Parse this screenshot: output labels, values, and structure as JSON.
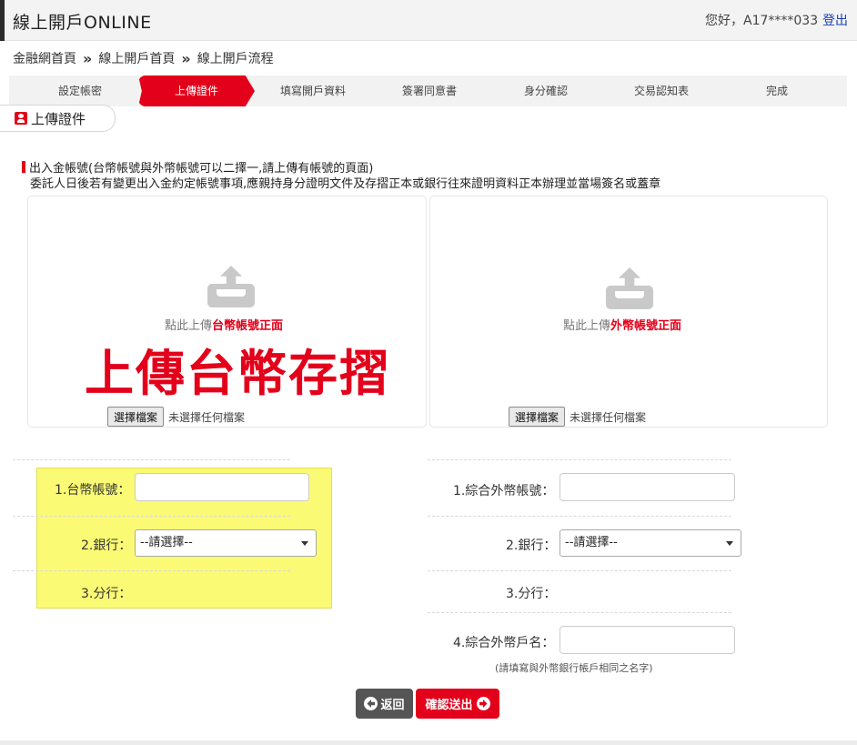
{
  "header": {
    "title": "線上開戶ONLINE",
    "greeting": "您好，",
    "user_id": "A17****033",
    "logout": "登出"
  },
  "breadcrumb": {
    "items": [
      "金融網首頁",
      "線上開戶首頁",
      "線上開戶流程"
    ],
    "separator": "»"
  },
  "steps": {
    "items": [
      "設定帳密",
      "上傳證件",
      "填寫開戶資料",
      "簽署同意書",
      "身分確認",
      "交易認知表",
      "完成"
    ],
    "active_index": 1
  },
  "section": {
    "title": "上傳證件",
    "icon": "id-card-icon"
  },
  "notes": {
    "line1": "出入金帳號(台幣帳號與外幣帳號可以二擇一,請上傳有帳號的頁面)",
    "line2": "委託人日後若有變更出入金約定帳號事項,應親持身分證明文件及存摺正本或銀行往來證明資料正本辦理並當場簽名或蓋章"
  },
  "upload": {
    "left": {
      "hint_prefix": "點此上傳",
      "hint_highlight": "台幣帳號正面",
      "file_button": "選擇檔案",
      "file_status": "未選擇任何檔案",
      "overlay_text": "上傳台幣存摺"
    },
    "right": {
      "hint_prefix": "點此上傳",
      "hint_highlight": "外幣帳號正面",
      "file_button": "選擇檔案",
      "file_status": "未選擇任何檔案"
    }
  },
  "form": {
    "twd": {
      "account_label": "1.台幣帳號：",
      "account_value": "",
      "bank_label": "2.銀行：",
      "bank_selected": "--請選擇--",
      "branch_label": "3.分行："
    },
    "foreign": {
      "account_label": "1.綜合外幣帳號：",
      "account_value": "",
      "bank_label": "2.銀行：",
      "bank_selected": "--請選擇--",
      "branch_label": "3.分行：",
      "name_label": "4.綜合外幣戶名：",
      "name_value": "",
      "name_note": "(請填寫與外幣銀行帳戶相同之名字)"
    }
  },
  "buttons": {
    "back": "返回",
    "submit": "確認送出"
  },
  "colors": {
    "accent": "#e3001a",
    "highlight": "#fafa66",
    "link": "#1a3fb0"
  }
}
